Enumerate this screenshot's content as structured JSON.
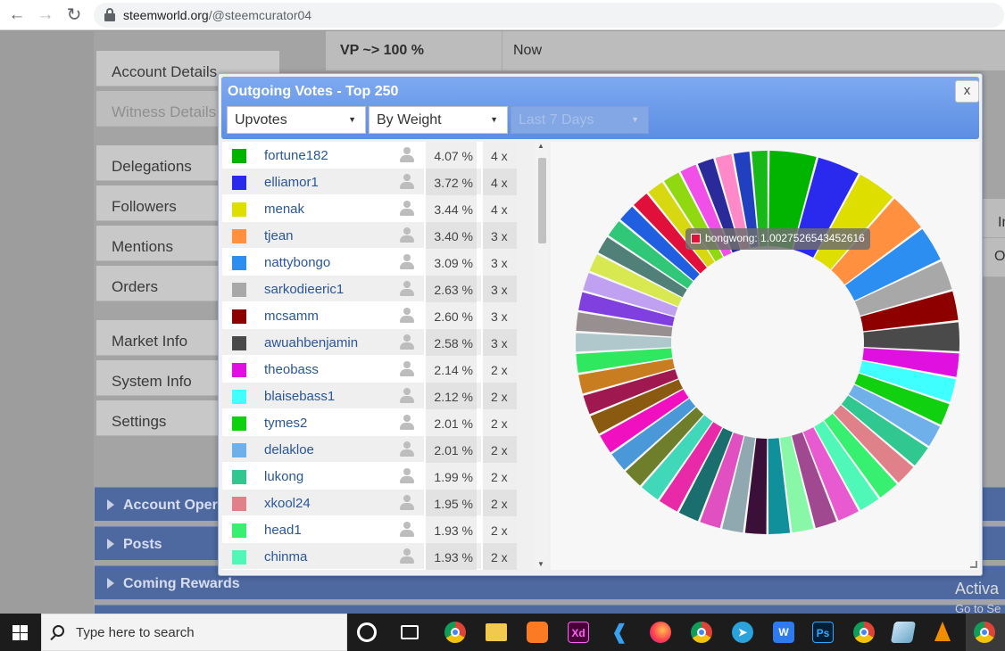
{
  "browser": {
    "back": "←",
    "forward": "→",
    "reload": "↻",
    "url_domain": "steemworld.org",
    "url_path": "/@steemcurator04"
  },
  "sidebar": {
    "items": [
      {
        "label": "Account Details"
      },
      {
        "label": "Witness Details"
      },
      {
        "label": "Delegations"
      },
      {
        "label": "Followers"
      },
      {
        "label": "Mentions"
      },
      {
        "label": "Orders"
      },
      {
        "label": "Market Info"
      },
      {
        "label": "System Info"
      },
      {
        "label": "Settings"
      }
    ]
  },
  "info": {
    "vp_label": "VP ~> 100 %",
    "vp_value": "Now",
    "strip_1": "Ir",
    "strip_2": "O"
  },
  "sections": [
    {
      "label": "Account Opera"
    },
    {
      "label": "Posts"
    },
    {
      "label": "Coming Rewards"
    }
  ],
  "dialog": {
    "title": "Outgoing Votes - Top 250",
    "close_label": "x",
    "dropdown_type": "Upvotes",
    "dropdown_sort": "By Weight",
    "dropdown_range": "Last 7 Days",
    "dropdown_arrow": "▼"
  },
  "votes": [
    {
      "name": "fortune182",
      "pct": "4.07 %",
      "count": "4 x",
      "color": "#00b400"
    },
    {
      "name": "elliamor1",
      "pct": "3.72 %",
      "count": "4 x",
      "color": "#2a2aee"
    },
    {
      "name": "menak",
      "pct": "3.44 %",
      "count": "4 x",
      "color": "#dede00"
    },
    {
      "name": "tjean",
      "pct": "3.40 %",
      "count": "3 x",
      "color": "#ff9040"
    },
    {
      "name": "nattybongo",
      "pct": "3.09 %",
      "count": "3 x",
      "color": "#2b8ef0"
    },
    {
      "name": "sarkodieeric1",
      "pct": "2.63 %",
      "count": "3 x",
      "color": "#a8a8a8"
    },
    {
      "name": "mcsamm",
      "pct": "2.60 %",
      "count": "3 x",
      "color": "#8e0000"
    },
    {
      "name": "awuahbenjamin",
      "pct": "2.58 %",
      "count": "3 x",
      "color": "#4a4a4a"
    },
    {
      "name": "theobass",
      "pct": "2.14 %",
      "count": "2 x",
      "color": "#e010e0"
    },
    {
      "name": "blaisebass1",
      "pct": "2.12 %",
      "count": "2 x",
      "color": "#40ffff"
    },
    {
      "name": "tymes2",
      "pct": "2.01 %",
      "count": "2 x",
      "color": "#10d010"
    },
    {
      "name": "delakloe",
      "pct": "2.01 %",
      "count": "2 x",
      "color": "#6fb0ea"
    },
    {
      "name": "lukong",
      "pct": "1.99 %",
      "count": "2 x",
      "color": "#30c890"
    },
    {
      "name": "xkool24",
      "pct": "1.95 %",
      "count": "2 x",
      "color": "#e08088"
    },
    {
      "name": "head1",
      "pct": "1.93 %",
      "count": "2 x",
      "color": "#38f070"
    },
    {
      "name": "chinma",
      "pct": "1.93 %",
      "count": "2 x",
      "color": "#50f8b8"
    }
  ],
  "chart_data": {
    "type": "pie",
    "donut": true,
    "legend": "none",
    "categories": [
      "fortune182",
      "elliamor1",
      "menak",
      "tjean",
      "nattybongo",
      "sarkodieeric1",
      "mcsamm",
      "awuahbenjamin",
      "theobass",
      "blaisebass1",
      "tymes2",
      "delakloe",
      "lukong",
      "xkool24",
      "head1",
      "chinma"
    ],
    "values": [
      4.07,
      3.72,
      3.44,
      3.4,
      3.09,
      2.63,
      2.6,
      2.58,
      2.14,
      2.12,
      2.01,
      2.01,
      1.99,
      1.95,
      1.93,
      1.93
    ],
    "colors": [
      "#00b400",
      "#2a2aee",
      "#dede00",
      "#ff9040",
      "#2b8ef0",
      "#a8a8a8",
      "#8e0000",
      "#4a4a4a",
      "#e010e0",
      "#40ffff",
      "#10d010",
      "#6fb0ea",
      "#30c890",
      "#e08088",
      "#38f070",
      "#50f8b8"
    ],
    "other_colors": [
      "#e85ad0",
      "#a04890",
      "#88f8a8",
      "#10909a",
      "#3a1038",
      "#90a8b0",
      "#e050c0",
      "#1a6e6e",
      "#e82aa8",
      "#40d8b8",
      "#6e7e2a",
      "#4a98d8",
      "#f010c0",
      "#8a5a10",
      "#a01850",
      "#c87e20",
      "#30e860",
      "#b0c8cc",
      "#989090",
      "#8040e0",
      "#c0a0f0",
      "#d8e850",
      "#508078",
      "#30c878",
      "#2060e0",
      "#e0103a",
      "#d8d810",
      "#90d810",
      "#f050e8",
      "#2a2a9a",
      "#ff88c8",
      "#2040c0",
      "#18b818"
    ],
    "other_weight": 2.0,
    "tooltip_label": "bongwong: 1.0027526543452616"
  },
  "watermark": {
    "line1": "Activa",
    "line2": "Go to Se"
  },
  "taskbar": {
    "search_placeholder": "Type here to search",
    "apps": [
      "cortana-icon",
      "task-view-icon",
      "chrome-icon",
      "file-explorer-icon",
      "xampp-icon",
      "adobe-xd-icon",
      "vscode-icon",
      "firefox-icon",
      "chrome-alt-icon",
      "telegram-icon",
      "wps-icon",
      "photoshop-icon",
      "chrome-profile-icon",
      "notepad-icon",
      "vlc-icon",
      "chrome-active-icon"
    ],
    "xd_label": "Xd",
    "ps_label": "Ps",
    "w_label": "W"
  }
}
